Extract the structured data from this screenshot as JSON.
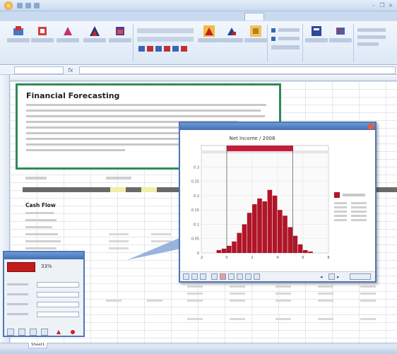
{
  "app": {
    "title": ""
  },
  "ribbon": {
    "tabs": [
      "",
      "",
      "",
      "",
      "",
      "",
      "",
      "",
      ""
    ],
    "active_tab_index": 8
  },
  "formula_bar": {
    "name_box": "",
    "formula": ""
  },
  "intro": {
    "title": "Financial Forecasting",
    "body": ""
  },
  "npv": {
    "label": "",
    "value": ""
  },
  "cashflow": {
    "title": "Cash Flow",
    "rows": [
      "",
      "",
      "",
      "",
      "",
      "",
      ""
    ]
  },
  "sim_window": {
    "chart_title": "Net Income / 2008",
    "x_axis_label": "",
    "y_axis_label": "",
    "close_label": ""
  },
  "chart_data": {
    "type": "bar",
    "title": "Net Income / 2008",
    "xlabel": "",
    "ylabel": "",
    "xlim": [
      -2,
      8
    ],
    "ylim": [
      0,
      0.35
    ],
    "x_ticks": [
      -2,
      0,
      2,
      4,
      6,
      8
    ],
    "y_ticks": [
      0,
      0.05,
      0.1,
      0.15,
      0.2,
      0.25,
      0.3
    ],
    "bins": [
      -0.8,
      -0.4,
      0,
      0.4,
      0.8,
      1.2,
      1.6,
      2,
      2.4,
      2.8,
      3.2,
      3.6,
      4,
      4.4,
      4.8,
      5.2,
      5.6,
      6,
      6.4
    ],
    "values": [
      0.01,
      0.015,
      0.025,
      0.04,
      0.07,
      0.1,
      0.14,
      0.17,
      0.19,
      0.18,
      0.22,
      0.2,
      0.15,
      0.13,
      0.09,
      0.06,
      0.03,
      0.01,
      0.005
    ],
    "delimiters": [
      0.0,
      5.2
    ],
    "colors": {
      "bar": "#b01528",
      "band": "#c41c3a",
      "grid": "#e0e0e0"
    }
  },
  "input_dialog": {
    "title": "",
    "percent": "33%"
  },
  "sheet_tabs": [
    "Sheet1"
  ],
  "status": ""
}
